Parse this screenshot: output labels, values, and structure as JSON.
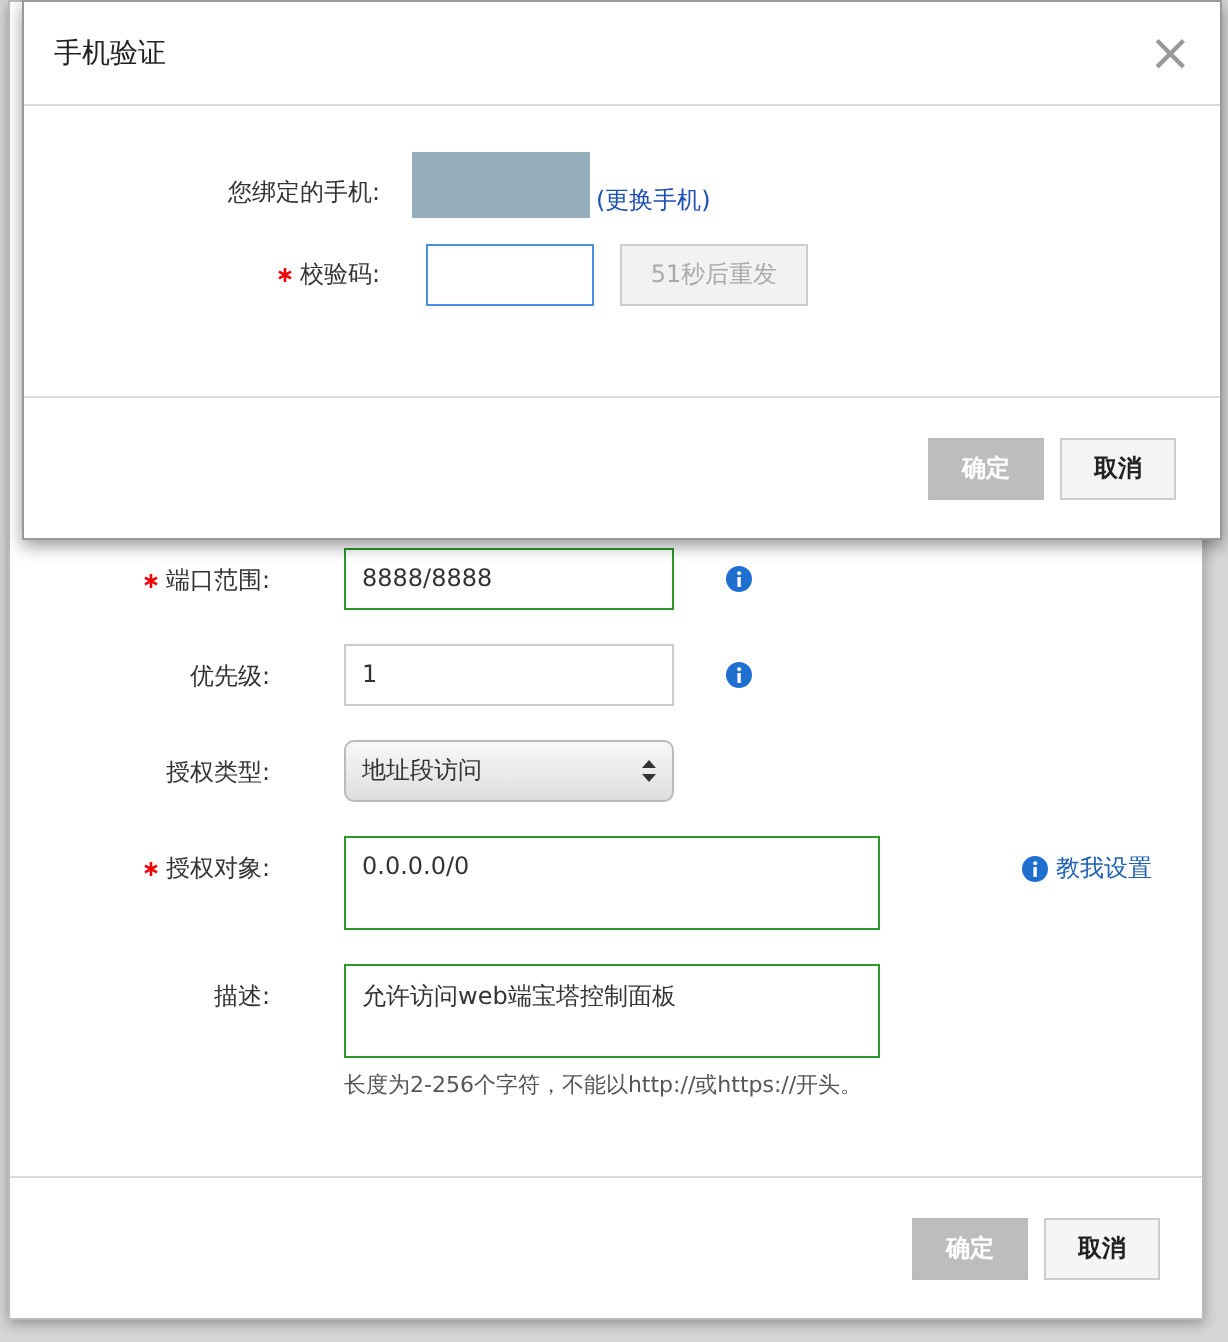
{
  "rule_form": {
    "fields": [
      {
        "label": "端口范围:",
        "required": true,
        "kind": "input",
        "value": "8888/8888",
        "valid": true,
        "info": true
      },
      {
        "label": "优先级:",
        "required": false,
        "kind": "input",
        "value": "1",
        "valid": false,
        "info": true
      },
      {
        "label": "授权类型:",
        "required": false,
        "kind": "select",
        "value": "地址段访问",
        "info": false
      },
      {
        "label": "授权对象:",
        "required": true,
        "kind": "textarea",
        "value": "0.0.0.0/0",
        "valid": true,
        "info": false,
        "help_link": "教我设置"
      },
      {
        "label": "描述:",
        "required": false,
        "kind": "textarea",
        "value": "允许访问web端宝塔控制面板",
        "valid": true,
        "info": false,
        "hint": "长度为2-256个字符，不能以http://或https://开头。"
      }
    ],
    "buttons": [
      {
        "label": "确定",
        "disabled": true
      },
      {
        "label": "取消",
        "disabled": false
      }
    ]
  },
  "phone_dialog": {
    "title": "手机验证",
    "close": "×",
    "phone_label": "您绑定的手机:",
    "change_link": "(更换手机)",
    "code_label": "校验码:",
    "code_required": true,
    "code_focused": true,
    "resend": {
      "label": "51秒后重发",
      "disabled": true
    },
    "buttons": [
      {
        "label": "确定",
        "disabled": true
      },
      {
        "label": "取消",
        "disabled": false
      }
    ]
  }
}
